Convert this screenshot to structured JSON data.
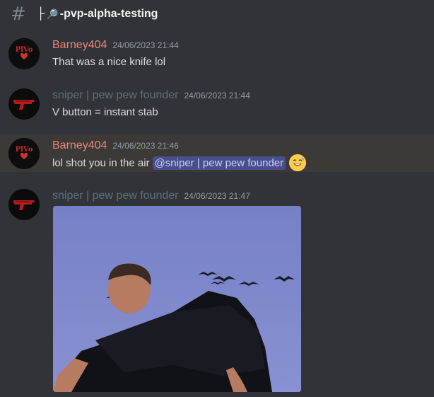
{
  "channel": {
    "name": "-pvp-alpha-testing",
    "prefix": "├",
    "icon": "magnifier-icon",
    "hash_icon": "#"
  },
  "messages": [
    {
      "author": "Barney404",
      "timestamp": "24/06/2023 21:44",
      "text": "That was a nice knife lol",
      "avatar": "plevo-avatar",
      "author_color": "#f1837b"
    },
    {
      "author": "sniper | pew pew founder",
      "timestamp": "24/06/2023 21:44",
      "text": "V button = instant stab",
      "avatar": "red-gun-avatar",
      "author_color": "#5e6f78"
    },
    {
      "author": "Barney404",
      "timestamp": "24/06/2023 21:46",
      "text": "lol shot you in the air",
      "mention": "@sniper | pew pew founder",
      "emoji": "sweat-smile-emoji",
      "avatar": "plevo-avatar",
      "author_color": "#f1837b",
      "highlighted": true
    },
    {
      "author": "sniper | pew pew founder",
      "timestamp": "24/06/2023 21:47",
      "attachment": "gif-image",
      "avatar": "red-gun-avatar",
      "author_color": "#5e6f78"
    }
  ],
  "avatar_text": "PlVo",
  "colors": {
    "background": "#313338",
    "highlight": "#3b3a36",
    "mention_bg": "#4a4e8c"
  }
}
